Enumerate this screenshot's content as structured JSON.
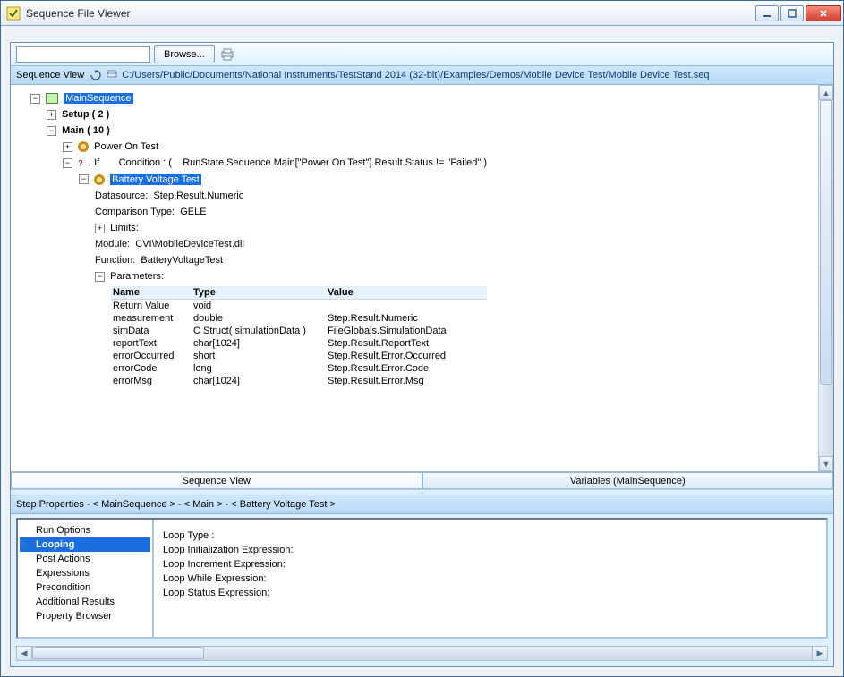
{
  "window": {
    "title": "Sequence File Viewer"
  },
  "toolbar": {
    "browse_label": "Browse..."
  },
  "seqview": {
    "label": "Sequence View",
    "file_path": "C:/Users/Public/Documents/National Instruments/TestStand 2014 (32-bit)/Examples/Demos/Mobile Device Test/Mobile Device Test.seq"
  },
  "tree": {
    "root": "MainSequence",
    "setup_label": "Setup  ( 2 )",
    "main_label": "Main  ( 10 )",
    "power_on": "Power On Test",
    "if_label": "If",
    "if_cond_lbl": "Condition : (",
    "if_cond_val": "RunState.Sequence.Main[\"Power On Test\"].Result.Status != \"Failed\" )",
    "battery": "Battery Voltage Test",
    "details": {
      "datasource_lbl": "Datasource:",
      "datasource_val": "Step.Result.Numeric",
      "comparison_lbl": "Comparison Type:",
      "comparison_val": "GELE",
      "limits_lbl": "Limits:",
      "module_lbl": "Module:",
      "module_val": "CVI\\MobileDeviceTest.dll",
      "function_lbl": "Function:",
      "function_val": "BatteryVoltageTest",
      "params_lbl": "Parameters:"
    },
    "param_headers": {
      "name": "Name",
      "type": "Type",
      "value": "Value"
    },
    "params": [
      {
        "name": "Return Value",
        "type": "void",
        "value": ""
      },
      {
        "name": "measurement",
        "type": "double",
        "value": "Step.Result.Numeric"
      },
      {
        "name": "simData",
        "type": "C Struct( simulationData )",
        "value": "FileGlobals.SimulationData"
      },
      {
        "name": "reportText",
        "type": "char[1024]",
        "value": "Step.Result.ReportText"
      },
      {
        "name": "errorOccurred",
        "type": "short",
        "value": "Step.Result.Error.Occurred"
      },
      {
        "name": "errorCode",
        "type": "long",
        "value": "Step.Result.Error.Code"
      },
      {
        "name": "errorMsg",
        "type": "char[1024]",
        "value": "Step.Result.Error.Msg"
      }
    ]
  },
  "tabs": {
    "sequence_view": "Sequence View",
    "variables": "Variables (MainSequence)"
  },
  "stepprops": {
    "header": "Step Properties - < MainSequence > - < Main > - < Battery Voltage Test >",
    "list": {
      "run_options": "Run Options",
      "looping": "Looping",
      "post_actions": "Post Actions",
      "expressions": "Expressions",
      "precondition": "Precondition",
      "additional_results": "Additional Results",
      "property_browser": "Property Browser"
    },
    "looping_detail": {
      "loop_type": "Loop Type :",
      "init": "Loop Initialization Expression:",
      "incr": "Loop Increment Expression:",
      "while": "Loop While Expression:",
      "status": "Loop Status Expression:"
    }
  }
}
